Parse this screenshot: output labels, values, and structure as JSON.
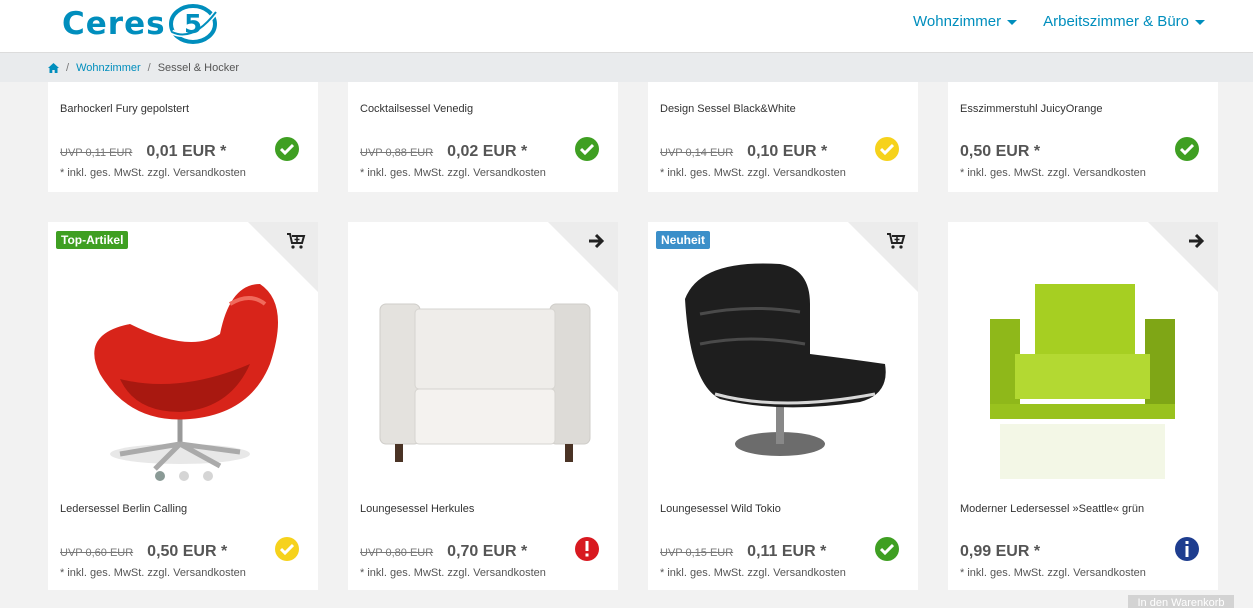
{
  "brand": {
    "logo_text": "Ceres",
    "logo_mark": "5",
    "accent": "#008ebd"
  },
  "nav": [
    {
      "label": "Wohnzimmer"
    },
    {
      "label": "Arbeitszimmer & Büro"
    }
  ],
  "breadcrumb": {
    "home_icon": "home-icon",
    "separator": "/",
    "items": [
      "Wohnzimmer",
      "Sessel & Hocker"
    ]
  },
  "products_top": [
    {
      "name": "Barhockerl Fury gepolstert",
      "rrp": "UVP 0,11 EUR",
      "price": "0,01 EUR *",
      "vat": "* inkl. ges. MwSt. zzgl. Versandkosten",
      "status": "available",
      "status_icon": "check-icon",
      "status_color": "#3f9f22"
    },
    {
      "name": "Cocktailsessel Venedig",
      "rrp": "UVP 0,88 EUR",
      "price": "0,02 EUR *",
      "vat": "* inkl. ges. MwSt. zzgl. Versandkosten",
      "status": "available",
      "status_icon": "check-icon",
      "status_color": "#3f9f22"
    },
    {
      "name": "Design Sessel Black&White",
      "rrp": "UVP 0,14 EUR",
      "price": "0,10 EUR *",
      "vat": "* inkl. ges. MwSt. zzgl. Versandkosten",
      "status": "limited",
      "status_icon": "check-icon",
      "status_color": "#f6d21c"
    },
    {
      "name": "Esszimmerstuhl JuicyOrange",
      "rrp": "",
      "price": "0,50 EUR *",
      "vat": "* inkl. ges. MwSt. zzgl. Versandkosten",
      "status": "available",
      "status_icon": "check-icon",
      "status_color": "#3f9f22"
    }
  ],
  "products_bottom": [
    {
      "name": "Ledersessel Berlin Calling",
      "badge": "Top-Artikel",
      "badge_color": "#3f9f22",
      "corner_icon": "add-to-cart-icon",
      "image": "red-egg-chair",
      "rrp": "UVP 0,60 EUR",
      "price": "0,50 EUR *",
      "vat": "* inkl. ges. MwSt. zzgl. Versandkosten",
      "status": "limited",
      "status_icon": "check-icon",
      "status_color": "#f6d21c",
      "carousel_dots": 3,
      "carousel_active": 1
    },
    {
      "name": "Loungesessel Herkules",
      "badge": "",
      "corner_icon": "arrow-right-icon",
      "image": "white-armchair",
      "rrp": "UVP 0,80 EUR",
      "price": "0,70 EUR *",
      "vat": "* inkl. ges. MwSt. zzgl. Versandkosten",
      "status": "unavailable",
      "status_icon": "exclamation-icon",
      "status_color": "#d81920"
    },
    {
      "name": "Loungesessel Wild Tokio",
      "badge": "Neuheit",
      "badge_color": "#3b8fc9",
      "corner_icon": "add-to-cart-icon",
      "image": "black-lounge-chair",
      "rrp": "UVP 0,15 EUR",
      "price": "0,11 EUR *",
      "vat": "* inkl. ges. MwSt. zzgl. Versandkosten",
      "status": "available",
      "status_icon": "check-icon",
      "status_color": "#3f9f22"
    },
    {
      "name": "Moderner Ledersessel »Seattle« grün",
      "badge": "",
      "corner_icon": "arrow-right-icon",
      "image": "green-armchair",
      "rrp": "",
      "price": "0,99 EUR *",
      "vat": "* inkl. ges. MwSt. zzgl. Versandkosten",
      "status": "info",
      "status_icon": "info-icon",
      "status_color": "#1e3d8f"
    }
  ],
  "cart_button": {
    "label": "In den Warenkorb"
  }
}
